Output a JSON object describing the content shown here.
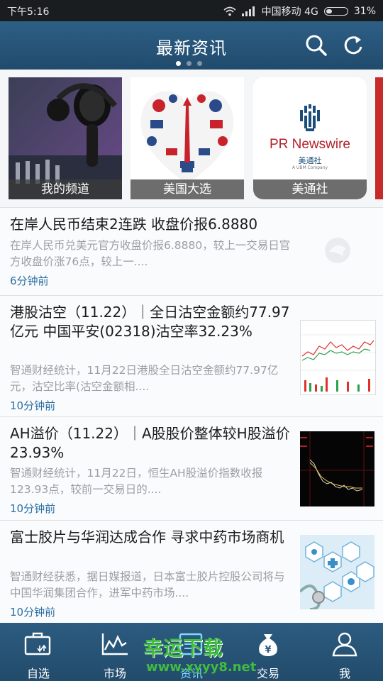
{
  "status": {
    "time": "下午5:16",
    "carrier": "中国移动 4G",
    "battery": "31%",
    "battery_level": 0.31
  },
  "header": {
    "title": "最新资讯",
    "page_dots": 3,
    "active_dot": 0,
    "icons": [
      "search-icon",
      "refresh-icon"
    ]
  },
  "channels": [
    {
      "label": "我的频道",
      "image": "studio-microphone-photo"
    },
    {
      "label": "美国大选",
      "image": "usa-symbols-heart-illustration"
    },
    {
      "label": "美通社",
      "image": "pr-newswire-logo",
      "logo": {
        "name": "PR Newswire",
        "cn": "美通社",
        "sub": "A UBM Company"
      }
    }
  ],
  "news": [
    {
      "title": "在岸人民币结束2连跌 收盘价报6.8880",
      "summary": "在岸人民币兑美元官方收盘价报6.8880，较上一交易日官方收盘价涨76点，较上一....",
      "time": "6分钟前",
      "thumb": "placeholder-logo"
    },
    {
      "title": "港股沽空（11.22）｜全日沽空金额约77.97亿元 中国平安(02318)沽空率32.23%",
      "summary": "智通财经统计，11月22日港股全日沽空金额约77.97亿元，沽空比率(沽空金额相....",
      "time": "10分钟前",
      "thumb": "stock-chart-light"
    },
    {
      "title": "AH溢价（11.22）｜A股股价整体较H股溢价23.93%",
      "summary": "智通财经统计，11月22日，恒生AH股溢价指数收报123.93点，较前一交易日的....",
      "time": "10分钟前",
      "thumb": "stock-chart-dark"
    },
    {
      "title": "富士胶片与华润达成合作 寻求中药市场商机",
      "summary": "智通财经获悉，据日媒报道，日本富士胶片控股公司将与中国华润集团合作，进军中药市场....",
      "time": "10分钟前",
      "thumb": "medical-hexagon-illustration"
    }
  ],
  "tabs": [
    {
      "label": "自选",
      "icon": "briefcase-icon"
    },
    {
      "label": "市场",
      "icon": "chart-icon"
    },
    {
      "label": "资讯",
      "icon": "news-icon",
      "active": true
    },
    {
      "label": "交易",
      "icon": "money-bag-icon"
    },
    {
      "label": "我",
      "icon": "user-icon"
    }
  ],
  "watermark": {
    "text": "幸运下载",
    "url": "www.xyyy8.net"
  },
  "colors": {
    "header": "#2a5a7f",
    "accent": "#2a6fa3",
    "active_tab": "#7fd6ff"
  }
}
